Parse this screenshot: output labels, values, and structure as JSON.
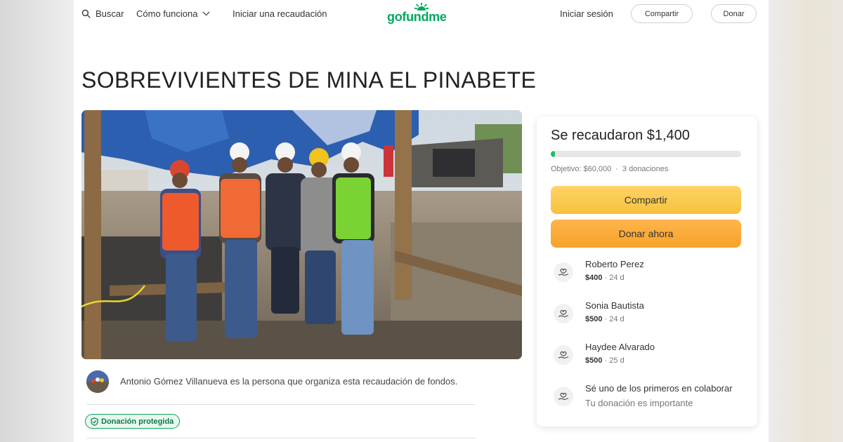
{
  "header": {
    "search_label": "Buscar",
    "how_it_works_label": "Cómo funciona",
    "start_label": "Iniciar una recaudación",
    "logo_text": "gofundme",
    "login_label": "Iniciar sesión",
    "share_label": "Compartir",
    "donate_label": "Donar"
  },
  "campaign": {
    "title": "SOBREVIVIENTES DE MINA EL PINABETE",
    "organizer_text": "Antonio Gómez Villanueva es la persona que organiza esta recaudación de fondos.",
    "protected_badge": "Donación protegida"
  },
  "donation_card": {
    "raised_text": "Se recaudaron $1,400",
    "progress_fraction": 0.023,
    "goal_text": "Objetivo: $60,000",
    "donations_count_text": "3 donaciones",
    "share_button": "Compartir",
    "donate_button": "Donar ahora",
    "donors": [
      {
        "name": "Roberto Perez",
        "amount": "$400",
        "time": "24 d"
      },
      {
        "name": "Sonia Bautista",
        "amount": "$500",
        "time": "24 d"
      },
      {
        "name": "Haydee Alvarado",
        "amount": "$500",
        "time": "25 d"
      }
    ],
    "cta": {
      "title": "Sé uno de los primeros en colaborar",
      "subtitle": "Tu donación es importante"
    }
  },
  "colors": {
    "brand_green": "#02a95c",
    "share_yellow": "#f6c23e",
    "donate_orange": "#f5a32b",
    "progress_green": "#1dbf63"
  },
  "icons": [
    "search-icon",
    "chevron-down-icon",
    "gofundme-sun-icon",
    "shield-check-icon",
    "heart-hand-icon"
  ]
}
